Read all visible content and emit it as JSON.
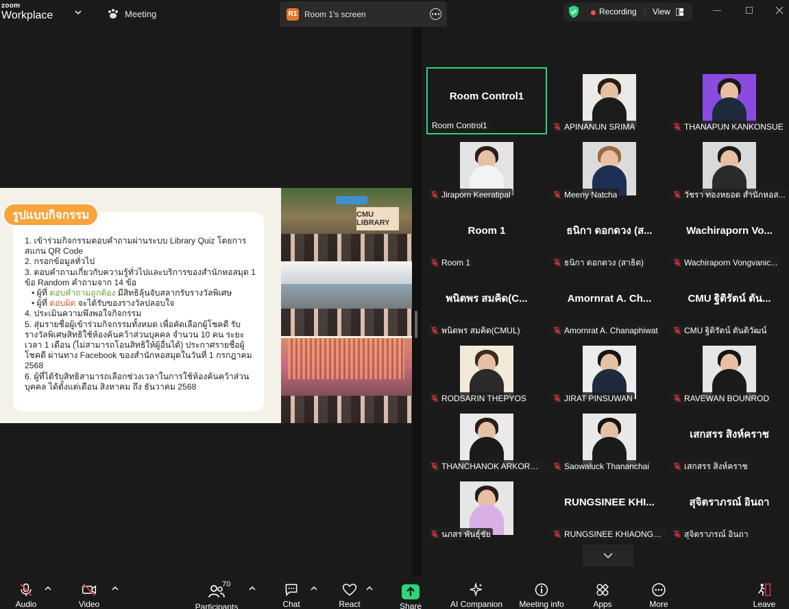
{
  "topbar": {
    "brand_small": "zoom",
    "brand_large": "Workplace",
    "meeting_label": "Meeting",
    "screen_badge": "R1",
    "screen_label": "Room 1's screen",
    "recording_label": "Recording",
    "view_label": "View"
  },
  "slide": {
    "title": "รูปแบบกิจกรรม",
    "lines": [
      "1. เข้าร่วมกิจกรรมตอบคำถามผ่านระบบ Library Quiz โดยการสแกน QR Code",
      "2. กรอกข้อมูลทั่วไป",
      "3. ตอบคำถามเกี่ยวกับความรู้ทั่วไปและบริการของสำนักหอสมุด 1 ข้อ Random คำถามจาก 14 ข้อ"
    ],
    "bullet1_prefix": "ผู้ที่ ",
    "bullet1_highlight": "ตอบคำถามถูกต้อง",
    "bullet1_suffix": " มีสิทธิลุ้นจับสลากรับรางวัลพิเศษ",
    "bullet2_prefix": "ผู้ที่ ",
    "bullet2_highlight": "ตอบผิด",
    "bullet2_suffix": " จะได้รับของรางวัลปลอบใจ",
    "lines_after": [
      "4. ประเมินความพึงพอใจกิจกรรม",
      "5. สุ่มรายชื่อผู้เข้าร่วมกิจกรรมทั้งหมด เพื่อคัดเลือกผู้โชคดี รับรางวัลพิเศษสิทธิใช้ห้องค้นคว้าส่วนบุคคล จำนวน 10 คน ระยะเวลา 1 เดือน (ไม่สามารถโอนสิทธิให้ผู้อื่นได้) ประกาศรายชื่อผู้โชคดี ผ่านทาง Facebook ของสำนักหอสมุดในวันที่ 1 กรกฎาคม 2568",
      "6. ผู้ที่ได้รับสิทธิสามารถเลือกช่วงเวลาในการใช้ห้องค้นคว้าส่วนบุคคล ได้ตั้งแต่เดือน สิงหาคม ถึง ธันวาคม 2568"
    ],
    "photo_sign": "CMU LIBRARY"
  },
  "gallery": {
    "tiles": [
      {
        "big": "Room Control1",
        "tag": "Room Control1",
        "photo": false,
        "active": true
      },
      {
        "big": "",
        "tag": "APINANUN SRIMA",
        "photo": true,
        "skin": "#1c1c1c",
        "hairc": "#2a1d18",
        "bg": "#eceae6"
      },
      {
        "big": "",
        "tag": "THANAPUN KANKONSUE",
        "photo": true,
        "skin": "#1e2a3a",
        "hairc": "#1a1a1a",
        "bg": "#8a4be0"
      },
      {
        "big": "",
        "tag": "Jiraporn Keeratipal",
        "photo": true,
        "skin": "#f3f3f3",
        "hairc": "#2a1d18",
        "bg": "#e4e4e4"
      },
      {
        "big": "",
        "tag": "Meeny Natcha",
        "photo": true,
        "skin": "#1d2f55",
        "hairc": "#9a6a3c",
        "bg": "#dcdcdc"
      },
      {
        "big": "",
        "tag": "วัชรา  ทองหยอด สำนักหอส...",
        "photo": true,
        "skin": "#2a2a2a",
        "hairc": "#1a1a1a",
        "bg": "#d9d9d9"
      },
      {
        "big": "Room 1",
        "tag": "Room 1",
        "photo": false
      },
      {
        "big": "ธนิกา ดอกดวง (ส...",
        "tag": "ธนิกา ดอกดวง (สาธิต)",
        "photo": false
      },
      {
        "big": "Wachiraporn  Vo...",
        "tag": "Wachiraporn Vongvanic...",
        "photo": false
      },
      {
        "big": "พนิตพร สมคิด(C...",
        "tag": "พนิตพร สมคิด(CMUL)",
        "photo": false
      },
      {
        "big": "Amornrat A. Ch...",
        "tag": "Amornrat A. Chanaphiwat",
        "photo": false
      },
      {
        "big": "CMU ฐิติรัตน์ ตัน...",
        "tag": "CMU ฐิติรัตน์ ตันติวัฒน์",
        "photo": false
      },
      {
        "big": "",
        "tag": "RODSARIN THEPYOS",
        "photo": true,
        "skin": "#2a2a2a",
        "hairc": "#3a2a20",
        "bg": "#f2e9d8"
      },
      {
        "big": "",
        "tag": "JIRAT PINSUWAN",
        "photo": true,
        "skin": "#1f2a3c",
        "hairc": "#151515",
        "bg": "#ececec"
      },
      {
        "big": "",
        "tag": "RAVEWAN BOUNROD",
        "photo": true,
        "skin": "#1b1b1b",
        "hairc": "#151515",
        "bg": "#e6e6e6"
      },
      {
        "big": "",
        "tag": "THANCHANOK ARKORN...",
        "photo": true,
        "skin": "#1b1b1b",
        "hairc": "#2a1d18",
        "bg": "#eaeaea"
      },
      {
        "big": "",
        "tag": "Saowaluck Thananchai",
        "photo": true,
        "skin": "#1b1b1b",
        "hairc": "#151515",
        "bg": "#e8e8e8"
      },
      {
        "big": "เสกสรร สิงห์คราช",
        "tag": "เสกสรร สิงห์คราช",
        "photo": false
      },
      {
        "big": "",
        "tag": "นภสร พันธุ์ชัย",
        "photo": true,
        "skin": "#d9b0e6",
        "hairc": "#2a1d18",
        "bg": "#e6e6e6"
      },
      {
        "big": "RUNGSINEE  KHI...",
        "tag": "RUNGSINEE KHIAONGA...",
        "photo": false
      },
      {
        "big": "สุจิตราภรณ์ อินถา",
        "tag": "สุจิตราภรณ์ อินถา",
        "photo": false
      }
    ]
  },
  "toolbar": {
    "audio": "Audio",
    "video": "Video",
    "participants": "Participants",
    "participants_count": "70",
    "chat": "Chat",
    "react": "React",
    "share": "Share",
    "ai_companion": "AI Companion",
    "meeting_info": "Meeting info",
    "apps": "Apps",
    "more": "More",
    "leave": "Leave"
  },
  "colors": {
    "active_border": "#2ed47a",
    "share_green": "#2ed47a",
    "mute_red": "#e0383e",
    "recording_red": "#ff4d4d",
    "leave_red": "#e0383e",
    "slide_title_orange": "#f5a53b"
  },
  "icons": [
    "zoom-logo",
    "chevron-down-icon",
    "paw-icon",
    "more-dots-icon",
    "shield-check-icon",
    "recording-dot-icon",
    "view-grid-icon",
    "minimize-icon",
    "maximize-icon",
    "close-icon",
    "mic-muted-icon",
    "video-off-icon",
    "participants-icon",
    "chat-icon",
    "react-heart-icon",
    "share-screen-icon",
    "ai-sparkle-icon",
    "info-icon",
    "apps-icon",
    "more-icon",
    "leave-icon"
  ]
}
